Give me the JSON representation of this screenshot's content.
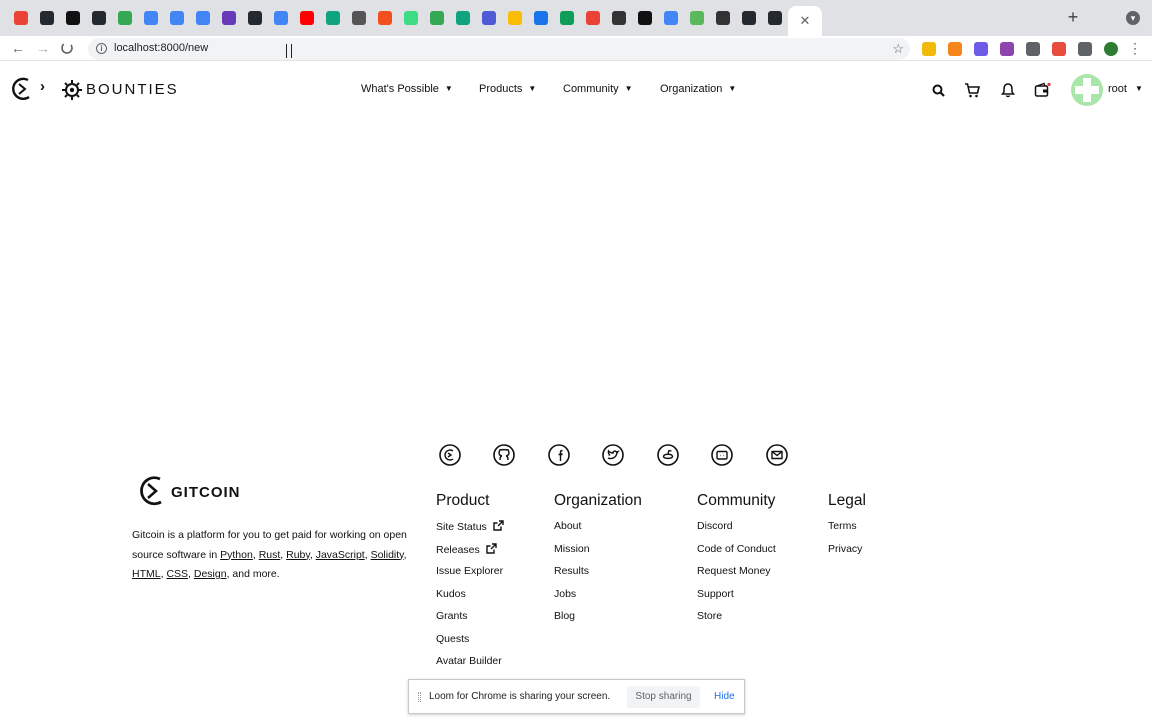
{
  "browser": {
    "tab_favicon_colors": [
      "#ea4335",
      "#24292f",
      "#111111",
      "#24292f",
      "#34a853",
      "#4285f4",
      "#4285f4",
      "#4285f4",
      "#673ab7",
      "#24292f",
      "#4285f4",
      "#ff0000",
      "#10a37f",
      "#555555",
      "#f24e1e",
      "#3ddc84",
      "#34a853",
      "#10a37f",
      "#4f5bd5",
      "#fbbc04",
      "#1a73e8",
      "#0f9d58",
      "#ea4335",
      "#333333",
      "#111111",
      "#4285f4",
      "#5cb85c",
      "#333333",
      "#24292f",
      "#24292f"
    ],
    "url": "localhost:8000/new",
    "new_tab_label": "+",
    "close_tab_label": "✕",
    "extension_colors": [
      "#f0b90b",
      "#f6851b",
      "#6c5ce7",
      "#8e44ad",
      "#5f6368",
      "#e74c3c",
      "#5f6368",
      "#2e7d32"
    ]
  },
  "header": {
    "brand": "BOUNTIES",
    "nav": [
      {
        "label": "What's Possible"
      },
      {
        "label": "Products"
      },
      {
        "label": "Community"
      },
      {
        "label": "Organization"
      }
    ],
    "user": "root"
  },
  "footer": {
    "logo_text": "GITCOIN",
    "about_intro": "Gitcoin is a platform for you to get paid for working on open source software in",
    "about_links": [
      "Python",
      "Rust",
      "Ruby",
      "JavaScript",
      "Solidity",
      "HTML",
      "CSS",
      "Design"
    ],
    "about_outro": "and more.",
    "columns": [
      {
        "title": "Product",
        "links": [
          "Site Status",
          "Releases",
          "Issue Explorer",
          "Kudos",
          "Grants",
          "Quests",
          "Avatar Builder"
        ]
      },
      {
        "title": "Organization",
        "links": [
          "About",
          "Mission",
          "Results",
          "Jobs",
          "Blog"
        ]
      },
      {
        "title": "Community",
        "links": [
          "Discord",
          "Code of Conduct",
          "Request Money",
          "Support",
          "Store"
        ]
      },
      {
        "title": "Legal",
        "links": [
          "Terms",
          "Privacy"
        ]
      }
    ],
    "social_icons": [
      "gitcoin-icon",
      "github-icon",
      "facebook-icon",
      "twitter-icon",
      "reddit-icon",
      "discord-icon",
      "email-icon"
    ]
  },
  "loom": {
    "message": "Loom for Chrome is sharing your screen.",
    "stop_label": "Stop sharing",
    "hide_label": "Hide"
  }
}
